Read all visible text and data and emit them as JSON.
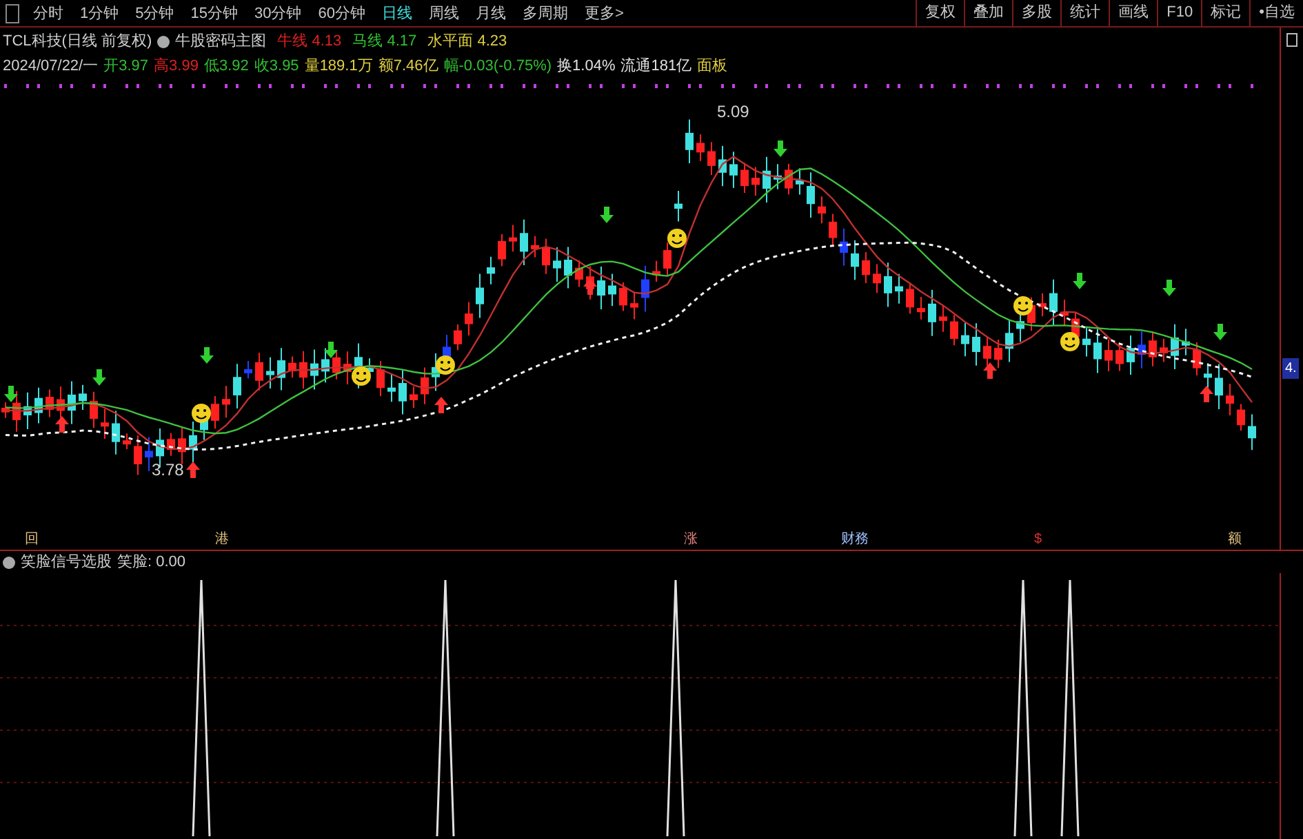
{
  "toolbar": {
    "periods": [
      {
        "label": "分时",
        "selected": false
      },
      {
        "label": "1分钟",
        "selected": false
      },
      {
        "label": "5分钟",
        "selected": false
      },
      {
        "label": "15分钟",
        "selected": false
      },
      {
        "label": "30分钟",
        "selected": false
      },
      {
        "label": "60分钟",
        "selected": false
      },
      {
        "label": "日线",
        "selected": true
      },
      {
        "label": "周线",
        "selected": false
      },
      {
        "label": "月线",
        "selected": false
      },
      {
        "label": "多周期",
        "selected": false
      },
      {
        "label": "更多>",
        "selected": false
      }
    ],
    "buttons": [
      "复权",
      "叠加",
      "多股",
      "统计",
      "画线",
      "F10",
      "标记",
      "•自选"
    ]
  },
  "stock_info": {
    "title": "TCL科技(日线 前复权)",
    "indicator": "牛股密码主图",
    "lines": [
      {
        "label": "牛线",
        "value": "4.13",
        "color": "#e02020"
      },
      {
        "label": "马线",
        "value": "4.17",
        "color": "#30c030"
      },
      {
        "label": "水平面",
        "value": "4.23",
        "color": "#e0d040"
      }
    ]
  },
  "quote": {
    "date": "2024/07/22/一",
    "items": [
      {
        "label": "开",
        "value": "3.97",
        "color": "#30c030"
      },
      {
        "label": "高",
        "value": "3.99",
        "color": "#e02020"
      },
      {
        "label": "低",
        "value": "3.92",
        "color": "#30c030"
      },
      {
        "label": "收",
        "value": "3.95",
        "color": "#30c030"
      },
      {
        "label": "量",
        "value": "189.1万",
        "color": "#e0d040"
      },
      {
        "label": "额",
        "value": "7.46亿",
        "color": "#e0d040"
      },
      {
        "label": "幅",
        "value": "-0.03(-0.75%)",
        "color": "#30c030"
      },
      {
        "label": "换",
        "value": "1.04%",
        "color": "#e0e0e0"
      },
      {
        "label": "流通",
        "value": "181亿",
        "color": "#e0e0e0"
      }
    ],
    "panel_link": "面板"
  },
  "main_chart": {
    "price_labels": [
      {
        "text": "5.09",
        "kind": "high"
      },
      {
        "text": "3.78",
        "kind": "low"
      }
    ],
    "axis_label": "4."
  },
  "event_markers": [
    {
      "label": "回",
      "color": "#e0c080"
    },
    {
      "label": "港",
      "color": "#e0c080"
    },
    {
      "label": "涨",
      "color": "#e08080"
    },
    {
      "label": "财務",
      "color": "#a0c0ff"
    },
    {
      "label": "$",
      "color": "#e03030"
    },
    {
      "label": "额",
      "color": "#e0c080"
    }
  ],
  "lower_panel": {
    "title": "笑脸信号选股",
    "reading_label": "笑脸:",
    "reading_value": "0.00"
  }
}
